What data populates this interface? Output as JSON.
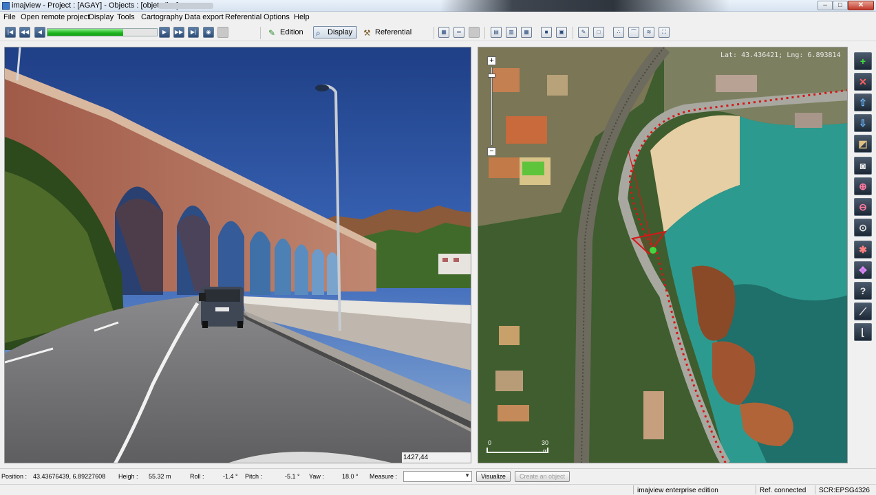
{
  "window": {
    "title": "imajview - Project : [AGAY] - Objects : [objets.ilox]",
    "min_label": "–",
    "max_label": "□",
    "close_label": "✕"
  },
  "menu": [
    "File",
    "Open remote project",
    "Display",
    "Tools",
    "Cartography",
    "Data export",
    "Referential",
    "Options",
    "Help"
  ],
  "toolbar": {
    "progress_fraction": 0.69,
    "modes": {
      "edition": "Edition",
      "display": "Display",
      "referential": "Referential"
    },
    "active_mode": "Display"
  },
  "photo": {
    "frame_readout": "1427,44"
  },
  "map": {
    "coords": "Lat: 43.436421; Lng: 6.893814",
    "zoom_in_label": "+",
    "zoom_out_label": "−",
    "scale_min": "0",
    "scale_max": "30",
    "scale_unit": "m"
  },
  "side_tools": [
    "add-icon",
    "delete-icon",
    "upload-icon",
    "download-icon",
    "eraser-icon",
    "camera-icon",
    "zoom-in-icon",
    "zoom-out-icon",
    "zoom-fit-icon",
    "settings-icon",
    "target-icon",
    "help-icon",
    "ruler-icon",
    "measure-icon"
  ],
  "bottom": {
    "position_label": "Position :",
    "position_value": "43.43676439, 6.89227608",
    "height_label": "Heigh :",
    "height_value": "55.32 m",
    "roll_label": "Roll :",
    "roll_value": "-1.4 °",
    "pitch_label": "Pitch :",
    "pitch_value": "-5.1 °",
    "yaw_label": "Yaw :",
    "yaw_value": "18.0 °",
    "measure_label": "Measure :",
    "measure_value": "",
    "visualize_button": "Visualize",
    "create_object_button": "Create an object"
  },
  "status": {
    "edition": "imajview enterprise edition",
    "connection": "Ref. connected",
    "srs": "SCR:EPSG4326"
  },
  "colors": {
    "track": "#d41818",
    "progress": "#1db31d",
    "sea": "#2d9a8f",
    "sky": "#254a8e"
  }
}
